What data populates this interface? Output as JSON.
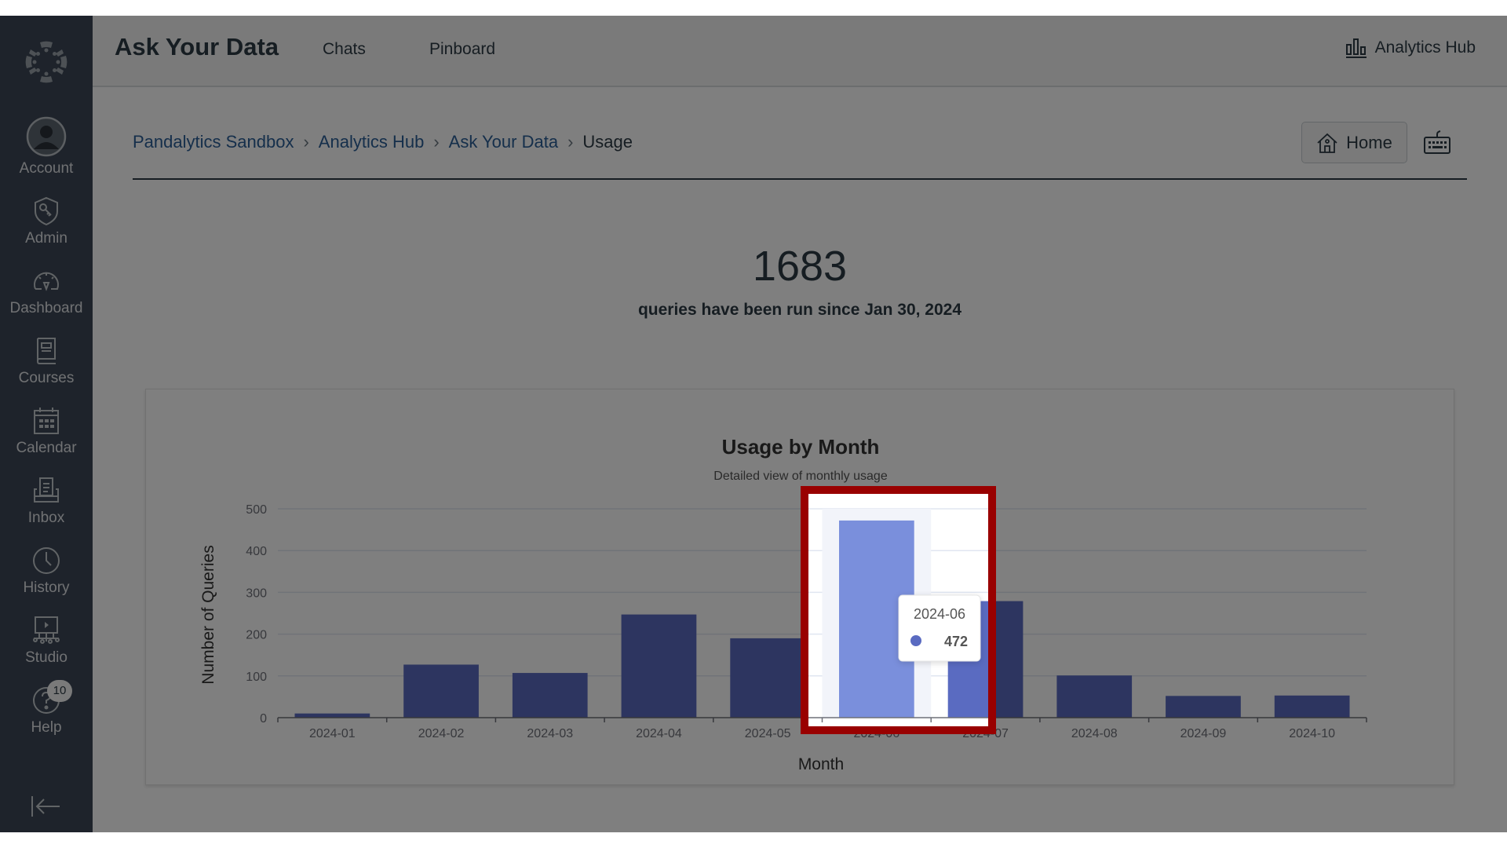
{
  "header": {
    "title": "Ask Your Data",
    "nav": [
      "Chats",
      "Pinboard"
    ],
    "hub_link": "Analytics Hub"
  },
  "sidebar": {
    "items": [
      {
        "label": "Account",
        "icon": "avatar-icon"
      },
      {
        "label": "Admin",
        "icon": "shield-key-icon"
      },
      {
        "label": "Dashboard",
        "icon": "speedometer-icon"
      },
      {
        "label": "Courses",
        "icon": "book-icon"
      },
      {
        "label": "Calendar",
        "icon": "calendar-icon"
      },
      {
        "label": "Inbox",
        "icon": "inbox-icon"
      },
      {
        "label": "History",
        "icon": "clock-icon"
      },
      {
        "label": "Studio",
        "icon": "studio-icon"
      },
      {
        "label": "Help",
        "icon": "help-icon",
        "badge": "10"
      }
    ]
  },
  "breadcrumb": {
    "links": [
      "Pandalytics Sandbox",
      "Analytics Hub",
      "Ask Your Data"
    ],
    "current": "Usage"
  },
  "actions": {
    "home_label": "Home"
  },
  "stats": {
    "total": "1683",
    "caption": "queries have been run since Jan 30, 2024"
  },
  "tooltip": {
    "label": "2024-06",
    "value": "472"
  },
  "colors": {
    "bar": "#5a6bc1",
    "bar_hover": "#7a8fdc",
    "highlight": "#990000"
  },
  "chart_data": {
    "type": "bar",
    "title": "Usage by Month",
    "subtitle": "Detailed view of monthly usage",
    "xlabel": "Month",
    "ylabel": "Number of Queries",
    "categories": [
      "2024-01",
      "2024-02",
      "2024-03",
      "2024-04",
      "2024-05",
      "2024-06",
      "2024-07",
      "2024-08",
      "2024-09",
      "2024-10"
    ],
    "values": [
      10,
      127,
      107,
      247,
      190,
      472,
      279,
      101,
      52,
      53
    ],
    "ylim": [
      0,
      500
    ],
    "yticks": [
      0,
      100,
      200,
      300,
      400,
      500
    ],
    "grid": true,
    "highlighted_category": "2024-06"
  }
}
